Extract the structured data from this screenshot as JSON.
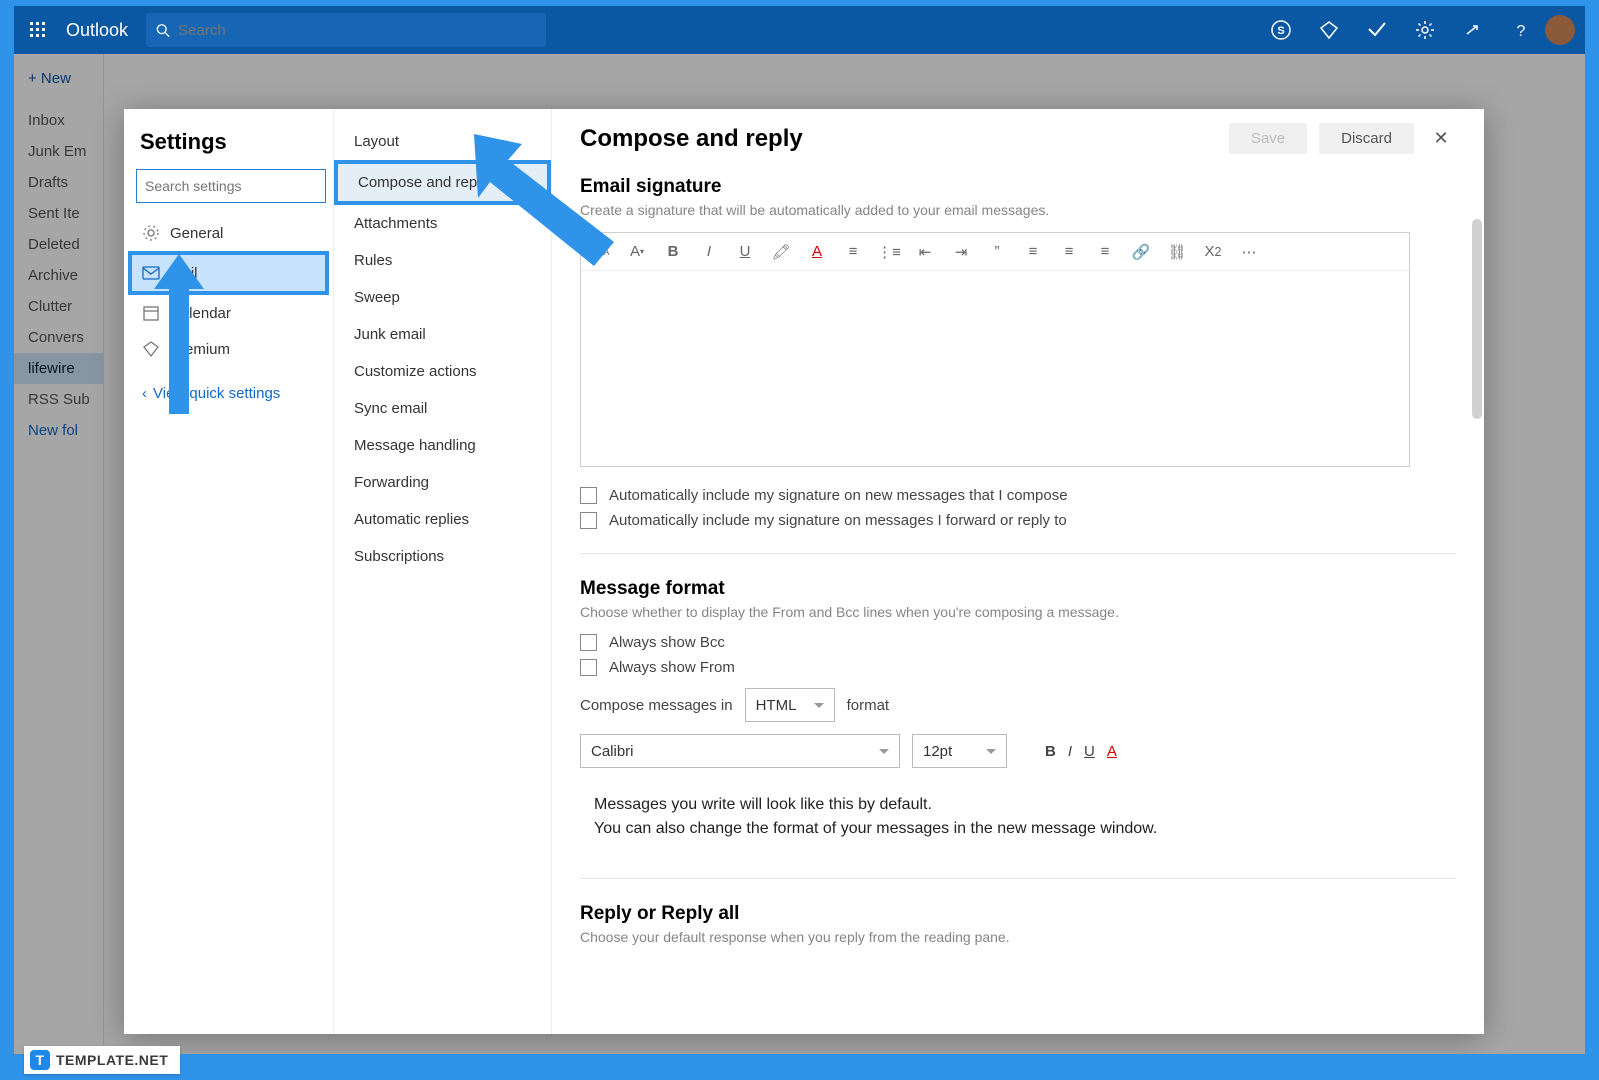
{
  "topbar": {
    "app_name": "Outlook",
    "search_placeholder": "Search"
  },
  "new_button": "+  New",
  "folders": [
    "Inbox",
    "Junk Em",
    "Drafts",
    "Sent Ite",
    "Deleted",
    "Archive",
    "Clutter",
    "Convers",
    "lifewire",
    "RSS Sub",
    "New fol"
  ],
  "settings": {
    "title": "Settings",
    "search_placeholder": "Search settings",
    "categories": {
      "general": "General",
      "mail": "Mail",
      "calendar": "Calendar",
      "premium": "Premium"
    },
    "quick_link": "View quick settings"
  },
  "sub_items": [
    "Layout",
    "Compose and reply",
    "Attachments",
    "Rules",
    "Sweep",
    "Junk email",
    "Customize actions",
    "Sync email",
    "Message handling",
    "Forwarding",
    "Automatic replies",
    "Subscriptions"
  ],
  "main": {
    "title": "Compose and reply",
    "save": "Save",
    "discard": "Discard",
    "sig_heading": "Email signature",
    "sig_sub": "Create a signature that will be automatically added to your email messages.",
    "cb1": "Automatically include my signature on new messages that I compose",
    "cb2": "Automatically include my signature on messages I forward or reply to",
    "fmt_heading": "Message format",
    "fmt_sub": "Choose whether to display the From and Bcc lines when you're composing a message.",
    "bcc": "Always show Bcc",
    "from": "Always show From",
    "compose_in_pre": "Compose messages in",
    "compose_in_sel": "HTML",
    "compose_in_post": "format",
    "font_sel": "Calibri",
    "size_sel": "12pt",
    "preview1": "Messages you write will look like this by default.",
    "preview2": "You can also change the format of your messages in the new message window.",
    "reply_heading": "Reply or Reply all",
    "reply_sub": "Choose your default response when you reply from the reading pane."
  },
  "badge": "TEMPLATE.NET"
}
